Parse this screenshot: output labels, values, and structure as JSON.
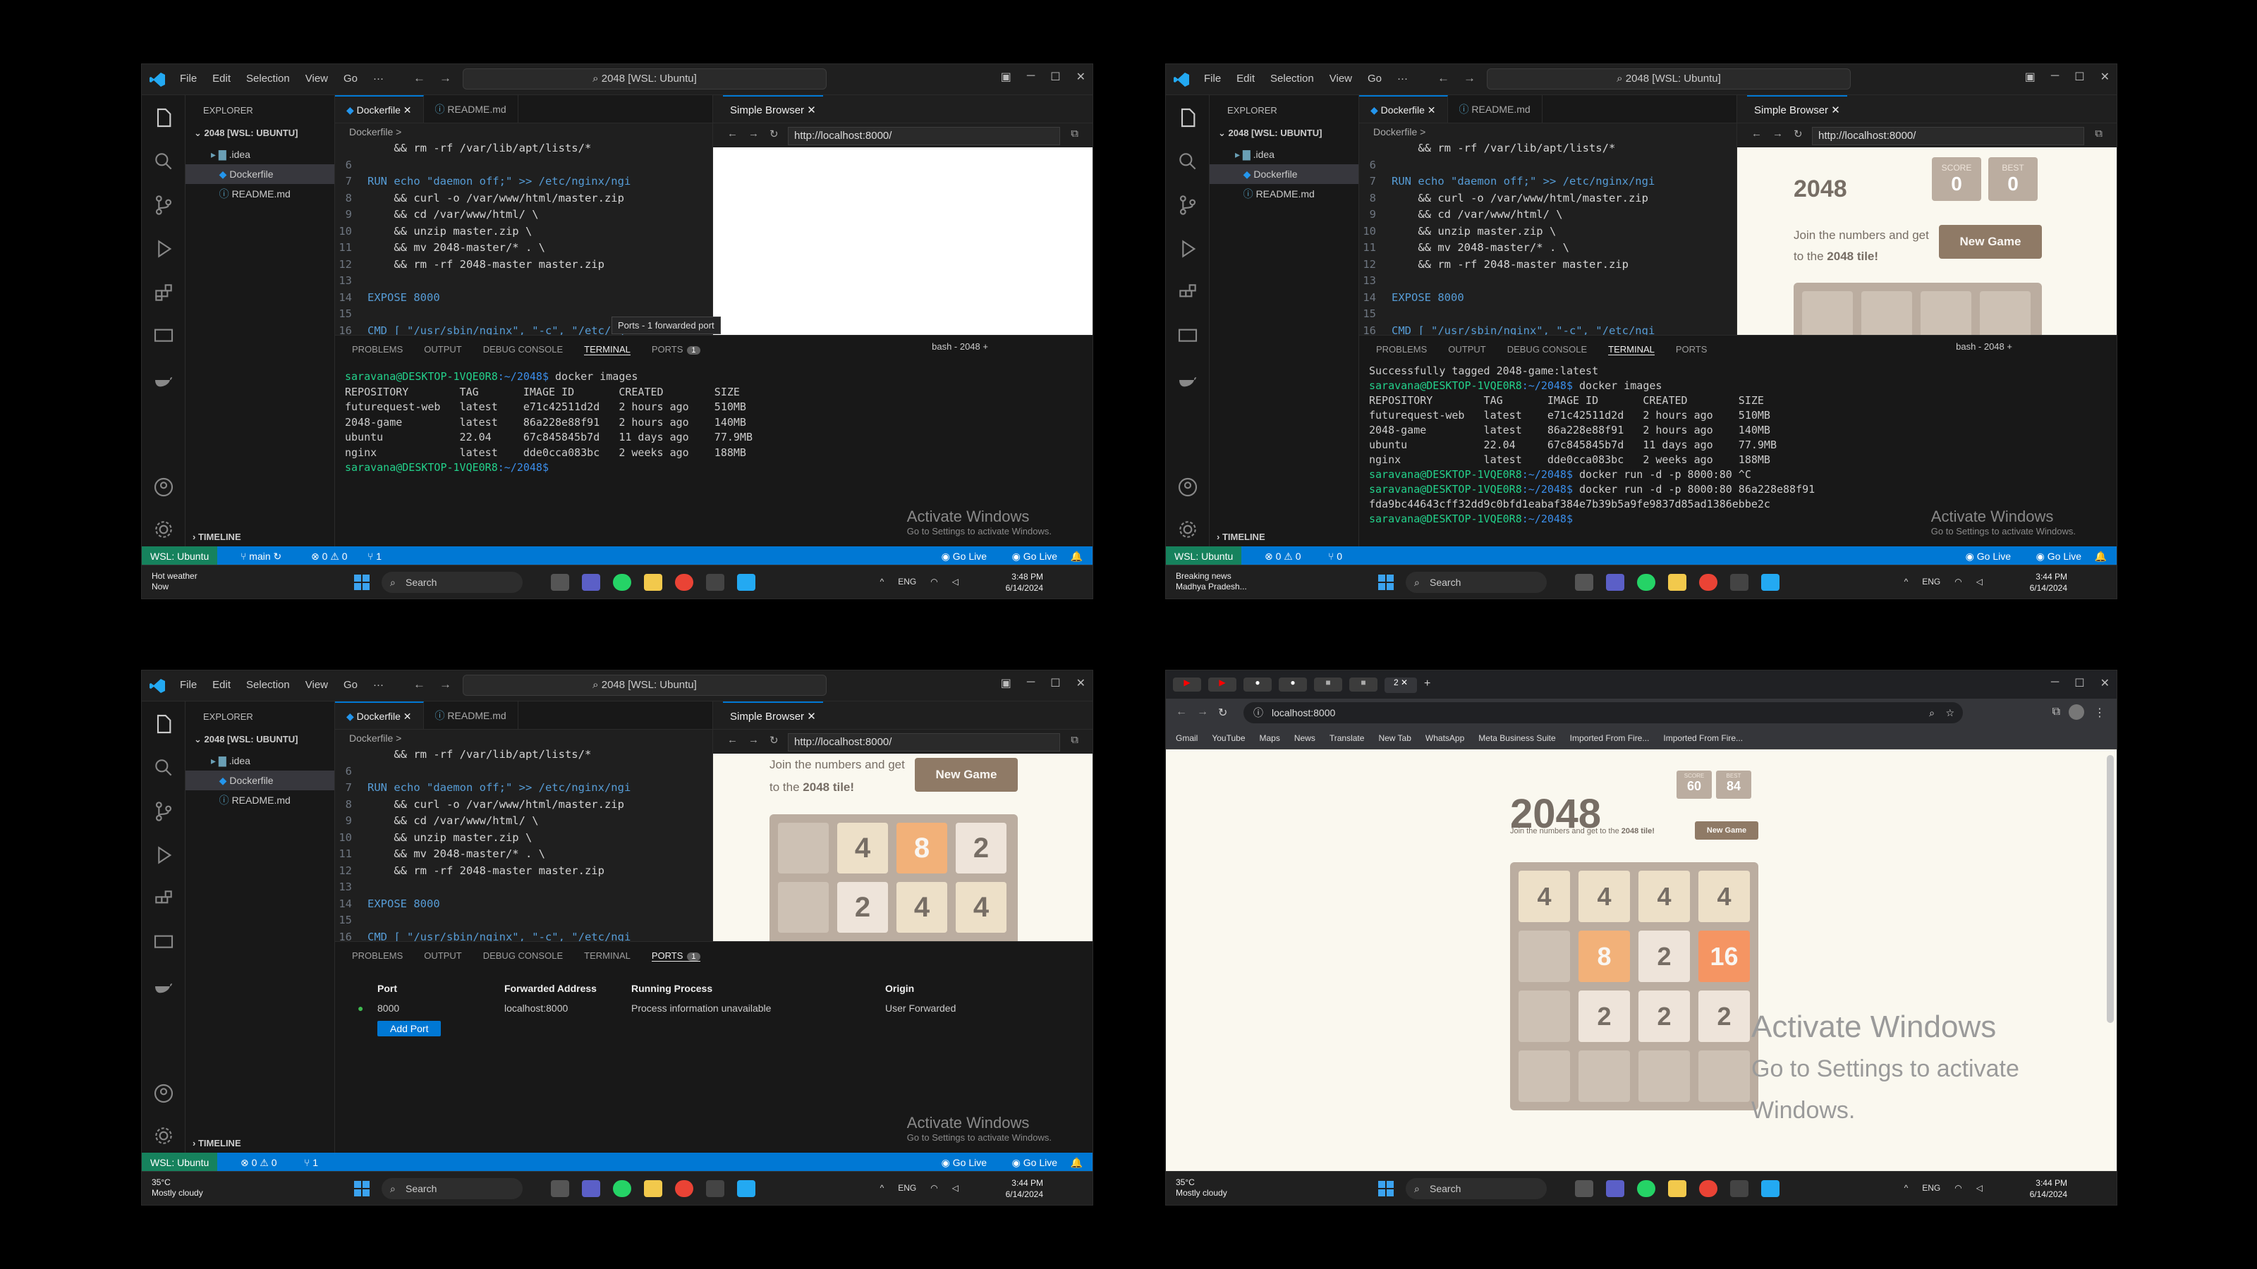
{
  "vscode": {
    "menu": [
      "File",
      "Edit",
      "Selection",
      "View",
      "Go",
      "···"
    ],
    "command_center": "2048 [WSL: Ubuntu]",
    "explorer": {
      "header": "EXPLORER",
      "root": "2048 [WSL: UBUNTU]",
      "items": [
        ".idea",
        "Dockerfile",
        "README.md"
      ],
      "timeline": "TIMELINE"
    },
    "tabs": [
      "Dockerfile",
      "README.md"
    ],
    "breadcrumb": "Dockerfile >",
    "code": [
      {
        "n": "",
        "t": "    && rm -rf /var/lib/apt/lists/*"
      },
      {
        "n": "6",
        "t": ""
      },
      {
        "n": "7",
        "t": "RUN echo \"daemon off;\" >> /etc/nginx/ngi"
      },
      {
        "n": "8",
        "t": "    && curl -o /var/www/html/master.zip"
      },
      {
        "n": "9",
        "t": "    && cd /var/www/html/ \\"
      },
      {
        "n": "10",
        "t": "    && unzip master.zip \\"
      },
      {
        "n": "11",
        "t": "    && mv 2048-master/* . \\"
      },
      {
        "n": "12",
        "t": "    && rm -rf 2048-master master.zip"
      },
      {
        "n": "13",
        "t": ""
      },
      {
        "n": "14",
        "t": "EXPOSE 8000"
      },
      {
        "n": "15",
        "t": ""
      },
      {
        "n": "16",
        "t": "CMD [ \"/usr/sbin/nginx\", \"-c\", \"/etc/ngi"
      }
    ],
    "browser_tab": "Simple Browser",
    "url": "http://localhost:8000/",
    "panel_tabs": [
      "PROBLEMS",
      "OUTPUT",
      "DEBUG CONSOLE",
      "TERMINAL",
      "PORTS"
    ],
    "ports_badge": "1",
    "terminal_label": "bash - 2048",
    "tooltip": "Ports - 1 forwarded port",
    "status": {
      "remote": "WSL: Ubuntu",
      "branch": "main",
      "problems": "⊗ 0 ⚠ 0",
      "ports": "⑂ 1",
      "golive": "Go Live"
    }
  },
  "terminal1": [
    {
      "p": "saravana@DESKTOP-1VQE0R8",
      "d": ":~/2048$",
      "c": " docker images"
    },
    {
      "o": "REPOSITORY        TAG       IMAGE ID       CREATED        SIZE"
    },
    {
      "o": "futurequest-web   latest    e71c42511d2d   2 hours ago    510MB"
    },
    {
      "o": "2048-game         latest    86a228e88f91   2 hours ago    140MB"
    },
    {
      "o": "ubuntu            22.04     67c845845b7d   11 days ago    77.9MB"
    },
    {
      "o": "nginx             latest    dde0cca083bc   2 weeks ago    188MB"
    },
    {
      "p": "saravana@DESKTOP-1VQE0R8",
      "d": ":~/2048$",
      "c": " "
    }
  ],
  "terminal2": [
    {
      "o": "Successfully tagged 2048-game:latest"
    },
    {
      "p": "saravana@DESKTOP-1VQE0R8",
      "d": ":~/2048$",
      "c": " docker images"
    },
    {
      "o": "REPOSITORY        TAG       IMAGE ID       CREATED        SIZE"
    },
    {
      "o": "futurequest-web   latest    e71c42511d2d   2 hours ago    510MB"
    },
    {
      "o": "2048-game         latest    86a228e88f91   2 hours ago    140MB"
    },
    {
      "o": "ubuntu            22.04     67c845845b7d   11 days ago    77.9MB"
    },
    {
      "o": "nginx             latest    dde0cca083bc   2 weeks ago    188MB"
    },
    {
      "p": "saravana@DESKTOP-1VQE0R8",
      "d": ":~/2048$",
      "c": " docker run -d -p 8000:80 ^C"
    },
    {
      "p": "saravana@DESKTOP-1VQE0R8",
      "d": ":~/2048$",
      "c": " docker run -d -p 8000:80 86a228e88f91"
    },
    {
      "o": "fda9bc44643cff32dd9c0bfd1eabaf384e7b39b5a9fe9837d85ad1386ebbe2c"
    },
    {
      "p": "saravana@DESKTOP-1VQE0R8",
      "d": ":~/2048$",
      "c": " "
    }
  ],
  "ports_table": {
    "headers": [
      "Port",
      "Forwarded Address",
      "Running Process",
      "Origin"
    ],
    "row": [
      "8000",
      "localhost:8000",
      "Process information unavailable",
      "User Forwarded"
    ],
    "add": "Add Port"
  },
  "game": {
    "title": "2048",
    "score_label": "SCORE",
    "best_label": "BEST",
    "score": "0",
    "best": "0",
    "intro": "Join the numbers and get to the",
    "goal": "2048 tile!",
    "new_game": "New Game",
    "score4": "60",
    "best4": "84"
  },
  "board3": [
    [
      "",
      "4",
      "8",
      "2"
    ],
    [
      "",
      "2",
      "4",
      "4"
    ]
  ],
  "board4": [
    [
      "4",
      "4",
      "4",
      "4"
    ],
    [
      "",
      "8",
      "2",
      "16"
    ],
    [
      "",
      "2",
      "2",
      "2"
    ],
    [
      "",
      "",
      "",
      ""
    ]
  ],
  "chrome": {
    "url": "localhost:8000",
    "bookmarks": [
      "Gmail",
      "YouTube",
      "Maps",
      "News",
      "Translate",
      "New Tab",
      "WhatsApp",
      "Meta Business Suite",
      "Imported From Fire...",
      "Imported From Fire..."
    ]
  },
  "watermark": {
    "title": "Activate Windows",
    "sub": "Go to Settings to activate Windows."
  },
  "taskbar": {
    "search": "Search",
    "lang": "ENG",
    "date": "6/14/2024",
    "time1": "3:48 PM",
    "time": "3:44 PM"
  },
  "weather": [
    {
      "a": "Hot weather",
      "b": "Now"
    },
    {
      "a": "Breaking news",
      "b": "Madhya Pradesh..."
    },
    {
      "a": "35°C",
      "b": "Mostly cloudy"
    },
    {
      "a": "35°C",
      "b": "Mostly cloudy"
    }
  ],
  "colors": {
    "vscode_blue": "#0078d4",
    "remote_green": "#16825d",
    "tile_empty": "#cdc1b4",
    "tile_2": "#eee4da",
    "tile_4": "#ede0c8",
    "tile_8": "#f2b179",
    "tile_16": "#f59563",
    "new_game": "#8f7a66"
  }
}
